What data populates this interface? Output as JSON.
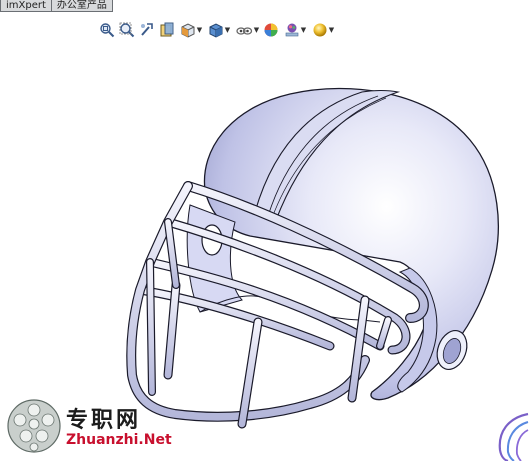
{
  "tabs": [
    {
      "label": "imXpert"
    },
    {
      "label": "办公室产品"
    }
  ],
  "toolbar": {
    "buttons": [
      {
        "icon": "zoom-to-fit-icon"
      },
      {
        "icon": "zoom-to-area-icon"
      },
      {
        "icon": "previous-view-icon"
      },
      {
        "icon": "section-view-icon"
      },
      {
        "icon": "view-orientation-icon"
      },
      {
        "icon": "display-style-icon"
      },
      {
        "icon": "hide-show-items-icon"
      },
      {
        "icon": "edit-appearance-icon"
      },
      {
        "icon": "apply-scene-icon"
      },
      {
        "icon": "view-settings-icon"
      }
    ]
  },
  "model": {
    "name": "football-helmet",
    "color": "#d6d8f2"
  },
  "watermark": {
    "chinese": "专职网",
    "domain": "Zhuanzhi.Net",
    "accent": "#c8102e"
  }
}
